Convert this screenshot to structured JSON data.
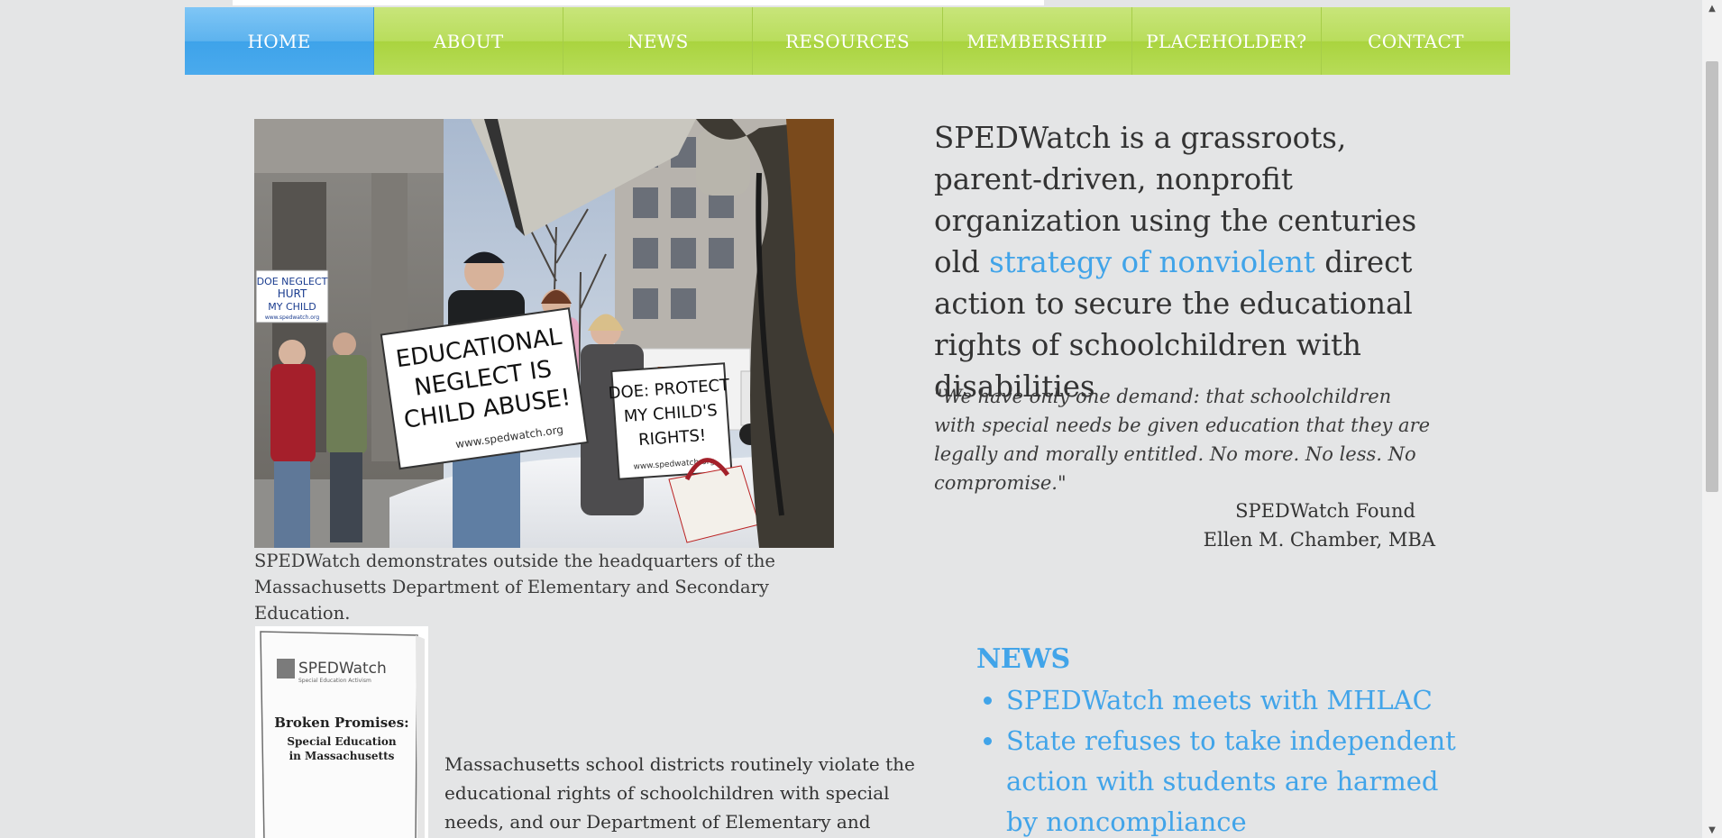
{
  "nav": {
    "items": [
      {
        "label": "HOME"
      },
      {
        "label": "ABOUT"
      },
      {
        "label": "NEWS"
      },
      {
        "label": "RESOURCES"
      },
      {
        "label": "MEMBERSHIP"
      },
      {
        "label": "PLACEHOLDER?"
      },
      {
        "label": "CONTACT"
      }
    ],
    "active_index": 0,
    "colors": {
      "active": "#4aaaed",
      "inactive": "#b7dc58"
    }
  },
  "hero": {
    "signs": {
      "left_sign": [
        "DOE NEGLECT",
        "HURT",
        "MY CHILD",
        "www.spedwatch.org"
      ],
      "main_sign": [
        "EDUCATIONAL",
        "NEGLECT IS",
        "CHILD ABUSE!",
        "www.spedwatch.org"
      ],
      "right_sign": [
        "DOE: PROTECT",
        "MY CHILD'S",
        "RIGHTS!",
        "www.spedwatch.org"
      ]
    },
    "caption": "SPEDWatch demonstrates outside the headquarters of the Massachusetts Department of Elementary and Secondary Education."
  },
  "mission": {
    "before": "SPEDWatch is a grassroots, parent-driven, nonprofit organization using the centuries old ",
    "link": "strategy of nonviolent",
    "after": " direct action to secure the educational rights of schoolchildren with disabilities"
  },
  "quote": {
    "text": "\"We have only one demand: that schoolchildren with special needs be given education that they are legally and morally entitled. No more. No less. No compromise.\"",
    "attribution_line1": "SPEDWatch Found",
    "attribution_line2": "Ellen M. Chamber, MBA"
  },
  "report": {
    "logo": "SPEDWatch",
    "tagline": "Special Education Activism",
    "title": "Broken Promises:",
    "subtitle_line1": "Special Education",
    "subtitle_line2": "in Massachusetts",
    "body": "Massachusetts school districts routinely violate the educational rights of schoolchildren with special needs, and our Department of Elementary and Secondary"
  },
  "news": {
    "heading": "NEWS",
    "items": [
      {
        "label": "SPEDWatch meets with MHLAC"
      },
      {
        "label": "State refuses to take independent action with students are harmed by noncompliance"
      }
    ],
    "link_color": "#41a4e9"
  },
  "scrollbar": {
    "up_icon": "triangle-up",
    "down_icon": "triangle-down"
  }
}
